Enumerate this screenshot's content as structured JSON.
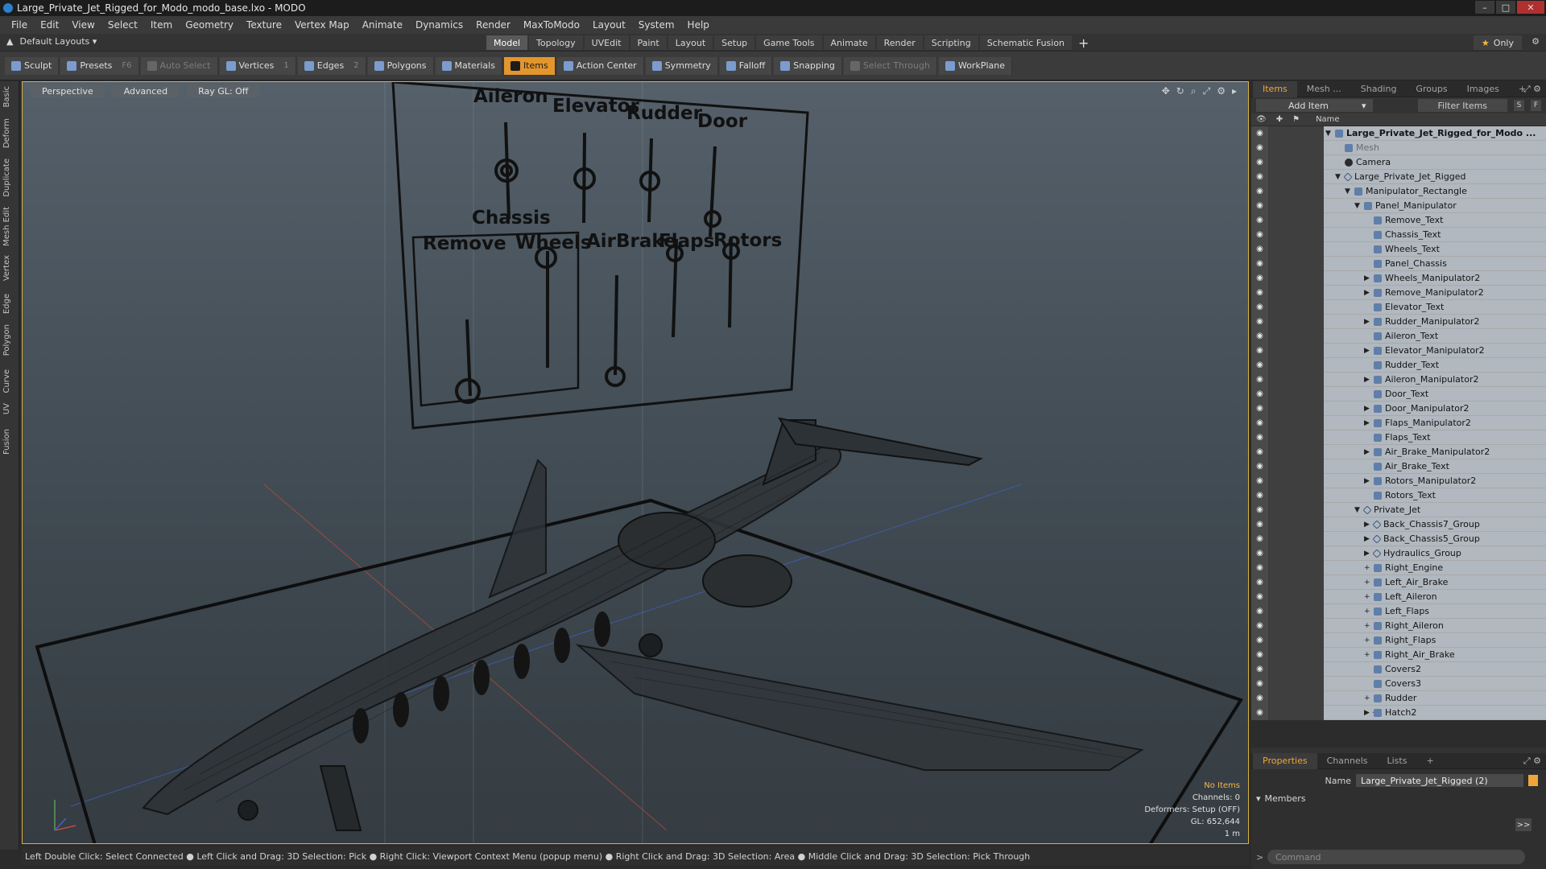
{
  "window": {
    "title": "Large_Private_Jet_Rigged_for_Modo_modo_base.lxo - MODO",
    "controls": [
      "–",
      "□",
      "✕"
    ]
  },
  "menu": [
    "File",
    "Edit",
    "View",
    "Select",
    "Item",
    "Geometry",
    "Texture",
    "Vertex Map",
    "Animate",
    "Dynamics",
    "Render",
    "MaxToModo",
    "Layout",
    "System",
    "Help"
  ],
  "layouts": {
    "dropdown": "Default Layouts ▾",
    "tabs": [
      "Model",
      "Topology",
      "UVEdit",
      "Paint",
      "Layout",
      "Setup",
      "Game Tools",
      "Animate",
      "Render",
      "Scripting",
      "Schematic Fusion"
    ],
    "active_tab": "Model",
    "plus": "+",
    "only": "Only",
    "star": "★",
    "gear": "⚙"
  },
  "toolbar": {
    "sculpt": "Sculpt",
    "presets": "Presets",
    "presets_key": "F6",
    "auto_select": "Auto Select",
    "vertices": "Vertices",
    "vertices_num": "1",
    "edges": "Edges",
    "edges_num": "2",
    "polygons": "Polygons",
    "materials": "Materials",
    "items": "Items",
    "action_center": "Action Center",
    "symmetry": "Symmetry",
    "falloff": "Falloff",
    "snapping": "Snapping",
    "select_through": "Select Through",
    "workplane": "WorkPlane"
  },
  "left_tabs": [
    "Basic",
    "Deform",
    "Duplicate",
    "Mesh Edit",
    "Vertex",
    "Edge",
    "Polygon",
    "Curve",
    "UV",
    "Fusion"
  ],
  "viewport": {
    "buttons": [
      "Perspective",
      "Advanced",
      "Ray GL: Off"
    ],
    "tool_icons": [
      "✥",
      "↻",
      "⌕",
      "⤢",
      "⚙",
      "▸"
    ],
    "panel_labels": [
      "Aileron",
      "Elevator",
      "Rudder",
      "Door",
      "Chassis",
      "Remove",
      "Wheels",
      "AirBrake",
      "Flaps",
      "Rotors"
    ],
    "info": {
      "no_items": "No Items",
      "channels": "Channels: 0",
      "deformers": "Deformers: Setup (OFF)",
      "gl": "GL: 652,644",
      "scale": "1 m"
    }
  },
  "status_bar": "Left Double Click: Select Connected ● Left Click and Drag: 3D Selection: Pick ● Right Click: Viewport Context Menu (popup menu) ● Right Click and Drag: 3D Selection: Area ● Middle Click and Drag: 3D Selection: Pick Through",
  "items_panel": {
    "tabs": [
      "Items",
      "Mesh ...",
      "Shading",
      "Groups",
      "Images",
      "+"
    ],
    "add_item": "Add Item",
    "filter": "Filter Items",
    "s": "S",
    "f": "F",
    "name_col": "Name",
    "tree": [
      {
        "label": "Large_Private_Jet_Rigged_for_Modo ...",
        "depth": 0,
        "exp": "▼",
        "icon": "scene",
        "root": true
      },
      {
        "label": "Mesh",
        "depth": 1,
        "exp": "",
        "icon": "mesh",
        "dim": true
      },
      {
        "label": "Camera",
        "depth": 1,
        "exp": "",
        "icon": "cam"
      },
      {
        "label": "Large_Private_Jet_Rigged",
        "depth": 1,
        "exp": "▼",
        "icon": "loc"
      },
      {
        "label": "Manipulator_Rectangle",
        "depth": 2,
        "exp": "▼",
        "icon": "mesh"
      },
      {
        "label": "Panel_Manipulator",
        "depth": 3,
        "exp": "▼",
        "icon": "mesh"
      },
      {
        "label": "Remove_Text",
        "depth": 4,
        "exp": "",
        "icon": "mesh"
      },
      {
        "label": "Chassis_Text",
        "depth": 4,
        "exp": "",
        "icon": "mesh"
      },
      {
        "label": "Wheels_Text",
        "depth": 4,
        "exp": "",
        "icon": "mesh"
      },
      {
        "label": "Panel_Chassis",
        "depth": 4,
        "exp": "",
        "icon": "mesh"
      },
      {
        "label": "Wheels_Manipulator2",
        "depth": 4,
        "exp": "▶",
        "icon": "mesh"
      },
      {
        "label": "Remove_Manipulator2",
        "depth": 4,
        "exp": "▶",
        "icon": "mesh"
      },
      {
        "label": "Elevator_Text",
        "depth": 4,
        "exp": "",
        "icon": "mesh"
      },
      {
        "label": "Rudder_Manipulator2",
        "depth": 4,
        "exp": "▶",
        "icon": "mesh"
      },
      {
        "label": "Aileron_Text",
        "depth": 4,
        "exp": "",
        "icon": "mesh"
      },
      {
        "label": "Elevator_Manipulator2",
        "depth": 4,
        "exp": "▶",
        "icon": "mesh"
      },
      {
        "label": "Rudder_Text",
        "depth": 4,
        "exp": "",
        "icon": "mesh"
      },
      {
        "label": "Aileron_Manipulator2",
        "depth": 4,
        "exp": "▶",
        "icon": "mesh"
      },
      {
        "label": "Door_Text",
        "depth": 4,
        "exp": "",
        "icon": "mesh"
      },
      {
        "label": "Door_Manipulator2",
        "depth": 4,
        "exp": "▶",
        "icon": "mesh"
      },
      {
        "label": "Flaps_Manipulator2",
        "depth": 4,
        "exp": "▶",
        "icon": "mesh"
      },
      {
        "label": "Flaps_Text",
        "depth": 4,
        "exp": "",
        "icon": "mesh"
      },
      {
        "label": "Air_Brake_Manipulator2",
        "depth": 4,
        "exp": "▶",
        "icon": "mesh"
      },
      {
        "label": "Air_Brake_Text",
        "depth": 4,
        "exp": "",
        "icon": "mesh"
      },
      {
        "label": "Rotors_Manipulator2",
        "depth": 4,
        "exp": "▶",
        "icon": "mesh"
      },
      {
        "label": "Rotors_Text",
        "depth": 4,
        "exp": "",
        "icon": "mesh"
      },
      {
        "label": "Private_Jet",
        "depth": 3,
        "exp": "▼",
        "icon": "loc"
      },
      {
        "label": "Back_Chassis7_Group",
        "depth": 4,
        "exp": "▶",
        "icon": "loc"
      },
      {
        "label": "Back_Chassis5_Group",
        "depth": 4,
        "exp": "▶",
        "icon": "loc"
      },
      {
        "label": "Hydraulics_Group",
        "depth": 4,
        "exp": "▶",
        "icon": "loc"
      },
      {
        "label": "Right_Engine",
        "depth": 4,
        "exp": "+",
        "icon": "mesh"
      },
      {
        "label": "Left_Air_Brake",
        "depth": 4,
        "exp": "+",
        "icon": "mesh"
      },
      {
        "label": "Left_Aileron",
        "depth": 4,
        "exp": "+",
        "icon": "mesh"
      },
      {
        "label": "Left_Flaps",
        "depth": 4,
        "exp": "+",
        "icon": "mesh"
      },
      {
        "label": "Right_Aileron",
        "depth": 4,
        "exp": "+",
        "icon": "mesh"
      },
      {
        "label": "Right_Flaps",
        "depth": 4,
        "exp": "+",
        "icon": "mesh"
      },
      {
        "label": "Right_Air_Brake",
        "depth": 4,
        "exp": "+",
        "icon": "mesh"
      },
      {
        "label": "Covers2",
        "depth": 4,
        "exp": "",
        "icon": "mesh"
      },
      {
        "label": "Covers3",
        "depth": 4,
        "exp": "",
        "icon": "mesh"
      },
      {
        "label": "Rudder",
        "depth": 4,
        "exp": "+",
        "icon": "mesh"
      },
      {
        "label": "Hatch2",
        "depth": 4,
        "exp": "▶ +",
        "icon": "mesh"
      }
    ]
  },
  "properties": {
    "tabs": [
      "Properties",
      "Channels",
      "Lists",
      "+"
    ],
    "name_label": "Name",
    "name_value": "Large_Private_Jet_Rigged (2)",
    "members": "Members",
    "forward": ">>",
    "command_placeholder": "Command"
  },
  "colors": {
    "accent": "#e3962b",
    "viewport_border": "#d8b23a",
    "tree_row": "#b1b8bf"
  }
}
